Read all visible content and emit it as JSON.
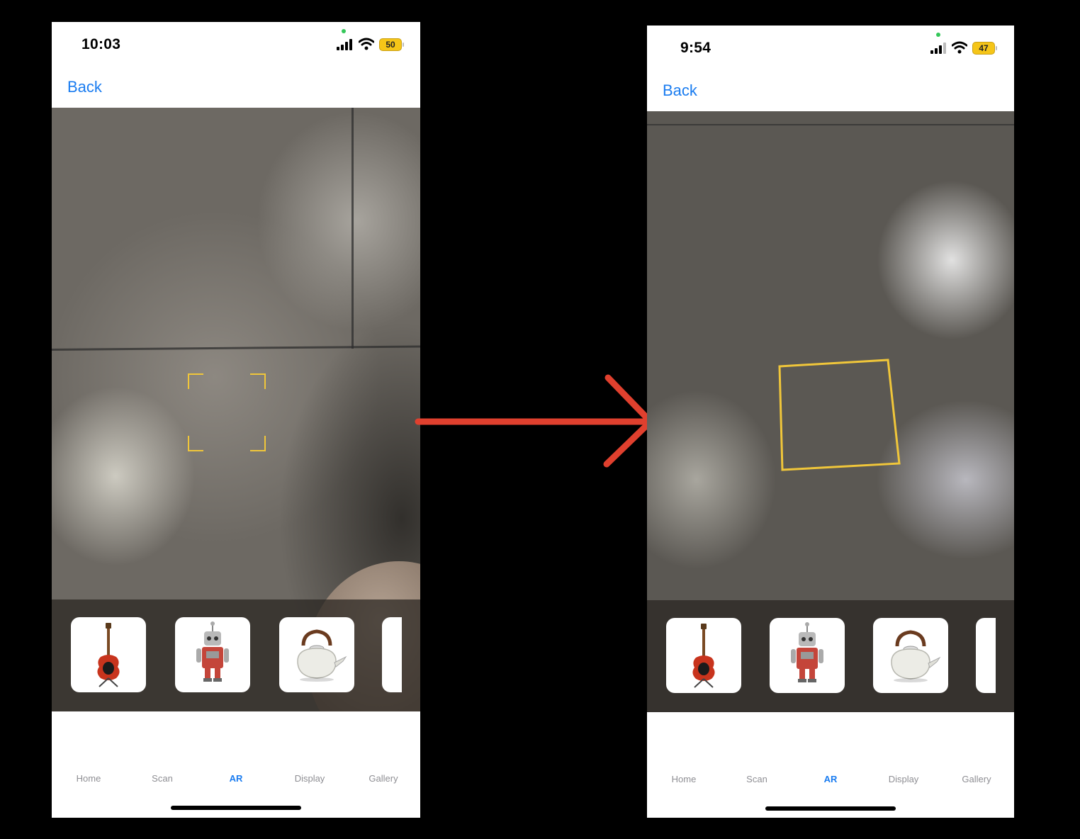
{
  "colors": {
    "accent": "#1a7cf0",
    "tab_inactive": "#8e8e93",
    "focus_yellow": "#f0c63a",
    "battery_yellow": "#f5c518",
    "arrow_red": "#e0402e"
  },
  "left_screen": {
    "status": {
      "time": "10:03",
      "battery": "50"
    },
    "nav": {
      "back_label": "Back"
    },
    "models": [
      "guitar-icon",
      "robot-icon",
      "kettle-icon",
      "partial-card"
    ],
    "tabs": [
      {
        "label": "Home"
      },
      {
        "label": "Scan"
      },
      {
        "label": "AR",
        "active": true
      },
      {
        "label": "Display"
      },
      {
        "label": "Gallery"
      }
    ]
  },
  "right_screen": {
    "status": {
      "time": "9:54",
      "battery": "47"
    },
    "nav": {
      "back_label": "Back"
    },
    "models": [
      "guitar-icon",
      "robot-icon",
      "kettle-icon",
      "partial-card"
    ],
    "tabs": [
      {
        "label": "Home"
      },
      {
        "label": "Scan"
      },
      {
        "label": "AR",
        "active": true
      },
      {
        "label": "Display"
      },
      {
        "label": "Gallery"
      }
    ]
  },
  "transition": {
    "icon": "arrow-right-icon"
  }
}
